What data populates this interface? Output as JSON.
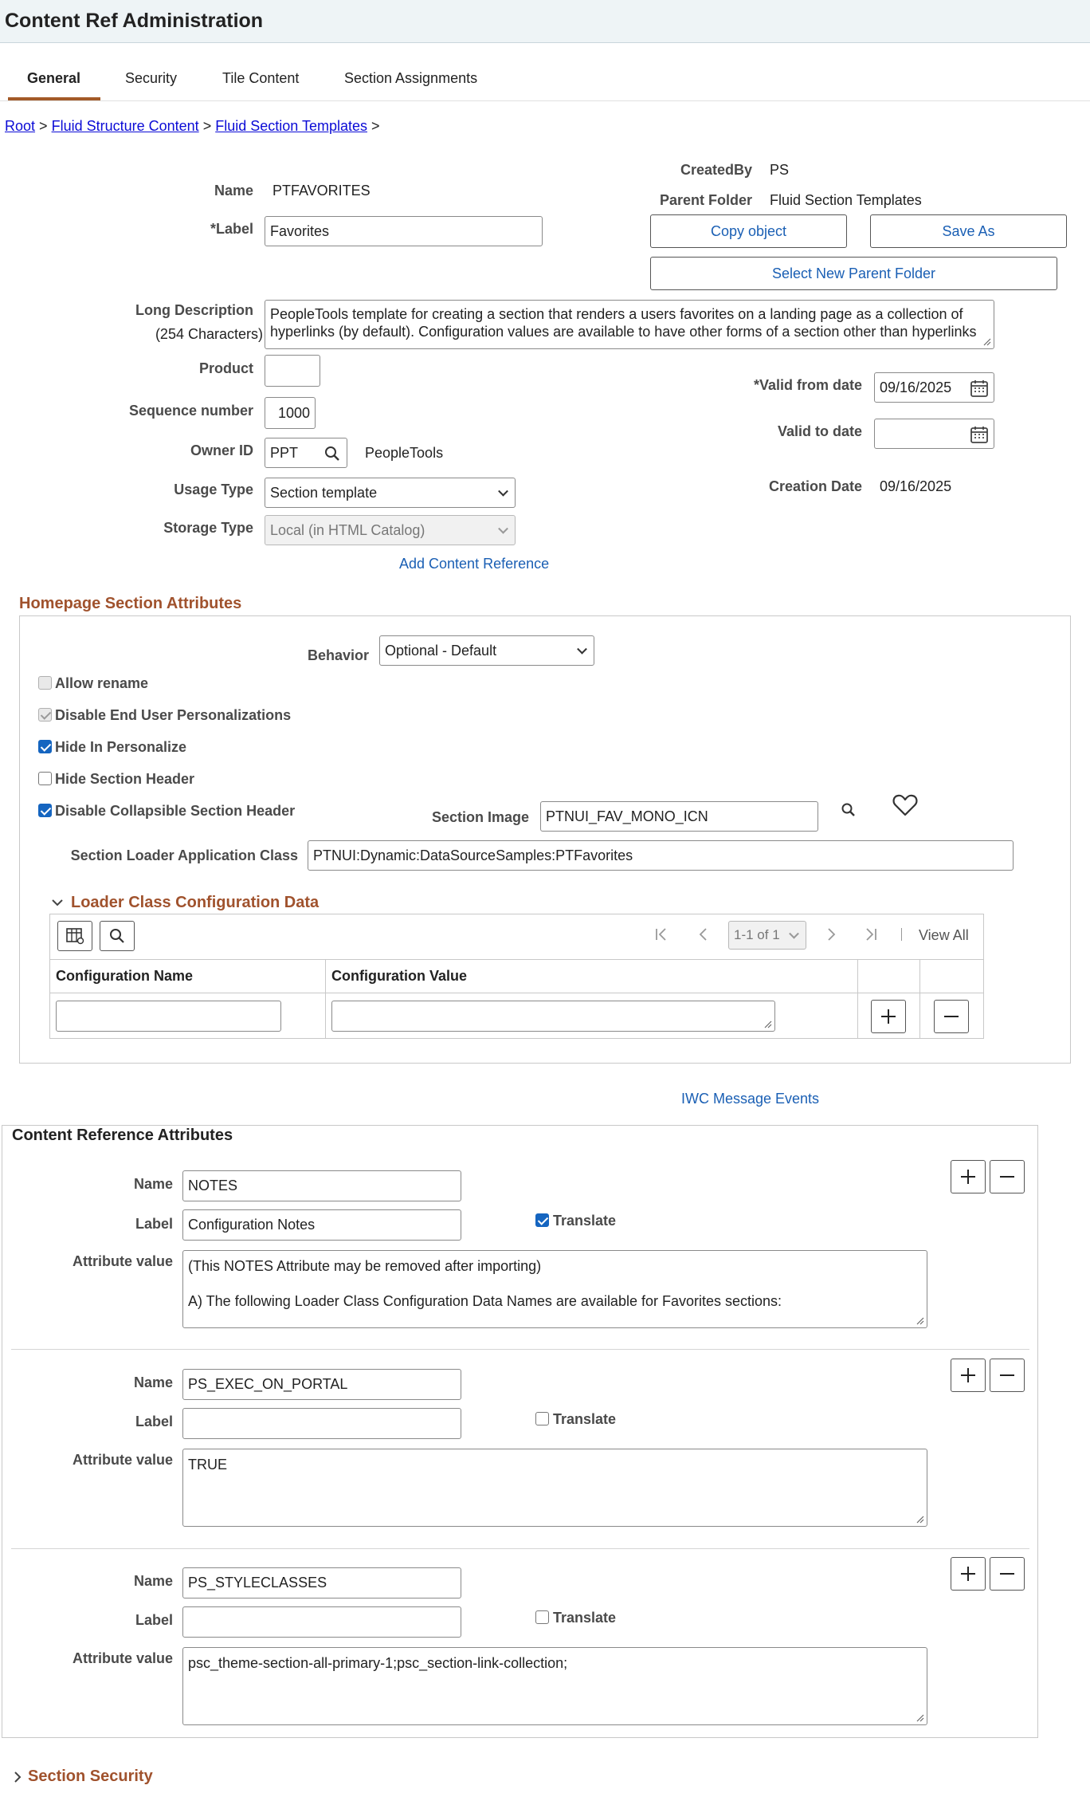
{
  "window": {
    "title": "Content Ref Administration"
  },
  "tabs": [
    "General",
    "Security",
    "Tile Content",
    "Section Assignments"
  ],
  "breadcrumb": {
    "root": "Root",
    "sep": ">",
    "items": [
      "Fluid Structure Content",
      "Fluid Section Templates"
    ]
  },
  "form": {
    "name_label": "Name",
    "name_value": "PTFAVORITES",
    "label_label": "*Label",
    "label_value": "Favorites",
    "createdby_label": "CreatedBy",
    "createdby_value": "PS",
    "parent_folder_label": "Parent Folder",
    "parent_folder_value": "Fluid Section Templates",
    "copy_object": "Copy object",
    "save_as": "Save As",
    "select_new_parent": "Select New Parent Folder",
    "long_desc_label": "Long Description",
    "long_desc_sub": "(254 Characters)",
    "long_desc_value": "PeopleTools template for creating a section that renders a users favorites on a landing page as a collection of hyperlinks (by default).  Configuration values are available to have other forms of a section other than hyperlinks",
    "product_label": "Product",
    "product_value": "",
    "sequence_label": "Sequence number",
    "sequence_value": "1000",
    "owner_label": "Owner ID",
    "owner_value": "PPT",
    "owner_desc": "PeopleTools",
    "usage_label": "Usage Type",
    "usage_value": "Section template",
    "storage_label": "Storage Type",
    "storage_value": "Local (in HTML Catalog)",
    "add_content_ref": "Add Content Reference",
    "valid_from_label": "*Valid from date",
    "valid_from_value": "09/16/2025",
    "valid_to_label": "Valid to date",
    "valid_to_value": "",
    "creation_label": "Creation Date",
    "creation_value": "09/16/2025"
  },
  "homepage": {
    "title": "Homepage Section Attributes",
    "behavior_label": "Behavior",
    "behavior_value": "Optional - Default",
    "checkboxes": [
      {
        "label": "Allow rename",
        "checked": false,
        "disabled": true
      },
      {
        "label": "Disable End User Personalizations",
        "checked": true,
        "disabled": true
      },
      {
        "label": "Hide In Personalize",
        "checked": true,
        "disabled": false
      },
      {
        "label": "Hide Section Header",
        "checked": false,
        "disabled": false
      },
      {
        "label": "Disable Collapsible Section Header",
        "checked": true,
        "disabled": false
      }
    ],
    "section_image_label": "Section Image",
    "section_image_value": "PTNUI_FAV_MONO_ICN",
    "loader_label": "Section Loader Application Class",
    "loader_value": "PTNUI:Dynamic:DataSourceSamples:PTFavorites",
    "loader_config": {
      "title": "Loader Class Configuration Data",
      "pager": "1-1 of 1",
      "view_all": "View All",
      "col_name": "Configuration Name",
      "col_value": "Configuration Value"
    }
  },
  "iwc": "IWC Message Events",
  "cref_attrs": {
    "title": "Content Reference Attributes",
    "name_label": "Name",
    "label_label": "Label",
    "translate_label": "Translate",
    "attr_label": "Attribute value",
    "items": [
      {
        "name": "NOTES",
        "label": "Configuration Notes",
        "translate": true,
        "value1": "(This NOTES Attribute may be removed after importing)",
        "value2": "A)  The following Loader Class Configuration Data Names are available for Favorites sections:"
      },
      {
        "name": "PS_EXEC_ON_PORTAL",
        "label": "",
        "translate": false,
        "value1": "TRUE",
        "value2": ""
      },
      {
        "name": "PS_STYLECLASSES",
        "label": "",
        "translate": false,
        "value1": "psc_theme-section-all-primary-1;psc_section-link-collection;",
        "value2": ""
      }
    ]
  },
  "section_security": "Section Security",
  "colors": {
    "accent": "#a0522d",
    "link": "#0b0bd6",
    "check": "#1565c0"
  }
}
